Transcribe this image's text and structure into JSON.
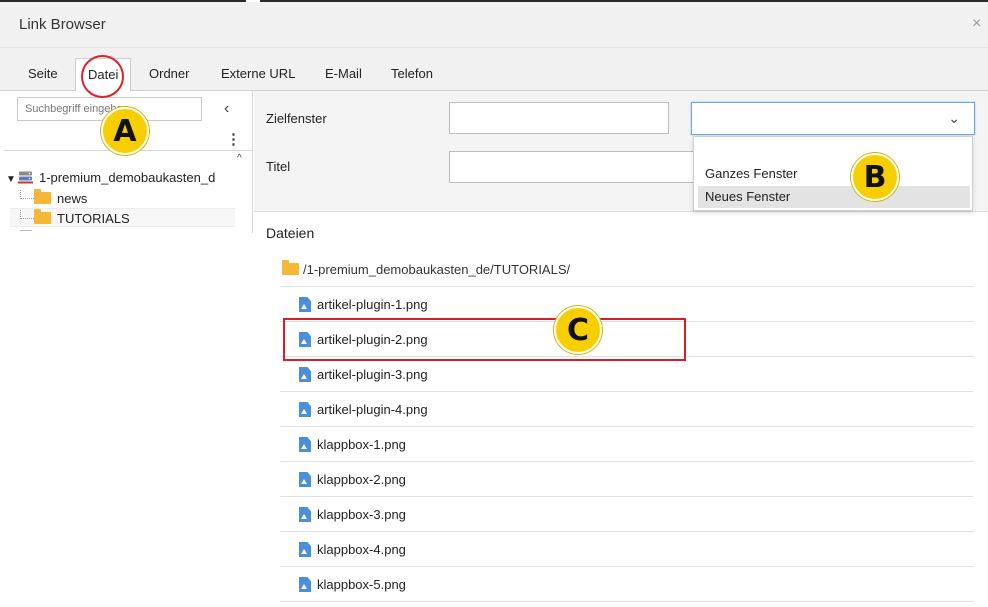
{
  "window": {
    "title": "Link Browser",
    "close_glyph": "×"
  },
  "tabs": [
    {
      "label": "Seite"
    },
    {
      "label": "Datei"
    },
    {
      "label": "Ordner"
    },
    {
      "label": "Externe URL"
    },
    {
      "label": "E-Mail"
    },
    {
      "label": "Telefon"
    }
  ],
  "sidebar": {
    "search_placeholder": "Suchbegriff eingeben",
    "collapse_glyph": "‹",
    "menu_glyph": "⋮",
    "scroll_glyph": "^",
    "tree": {
      "root": "1-premium_demobaukasten_d",
      "children": [
        "news",
        "TUTORIALS"
      ]
    }
  },
  "form": {
    "target_label": "Zielfenster",
    "target_value": "",
    "title_label": "Titel",
    "title_value": "",
    "chevron_glyph": "⌄",
    "target_options": [
      "Ganzes Fenster",
      "Neues Fenster"
    ],
    "highlighted_option": "Neues Fenster"
  },
  "files": {
    "heading": "Dateien",
    "path": "/1-premium_demobaukasten_de/TUTORIALS/",
    "items": [
      "artikel-plugin-1.png",
      "artikel-plugin-2.png",
      "artikel-plugin-3.png",
      "artikel-plugin-4.png",
      "klappbox-1.png",
      "klappbox-2.png",
      "klappbox-3.png",
      "klappbox-4.png",
      "klappbox-5.png"
    ]
  },
  "annotations": {
    "a": "A",
    "b": "B",
    "c": "C"
  },
  "colors": {
    "accent_yellow": "#f7cf00",
    "annotation_red": "#d4202a",
    "folder": "#f4b736",
    "file_icon": "#4a8fd8",
    "select_focus": "#6ea6e1"
  },
  "icons": {
    "folder": "folder-icon",
    "file": "image-file-icon",
    "server": "server-icon",
    "close": "close-icon"
  }
}
